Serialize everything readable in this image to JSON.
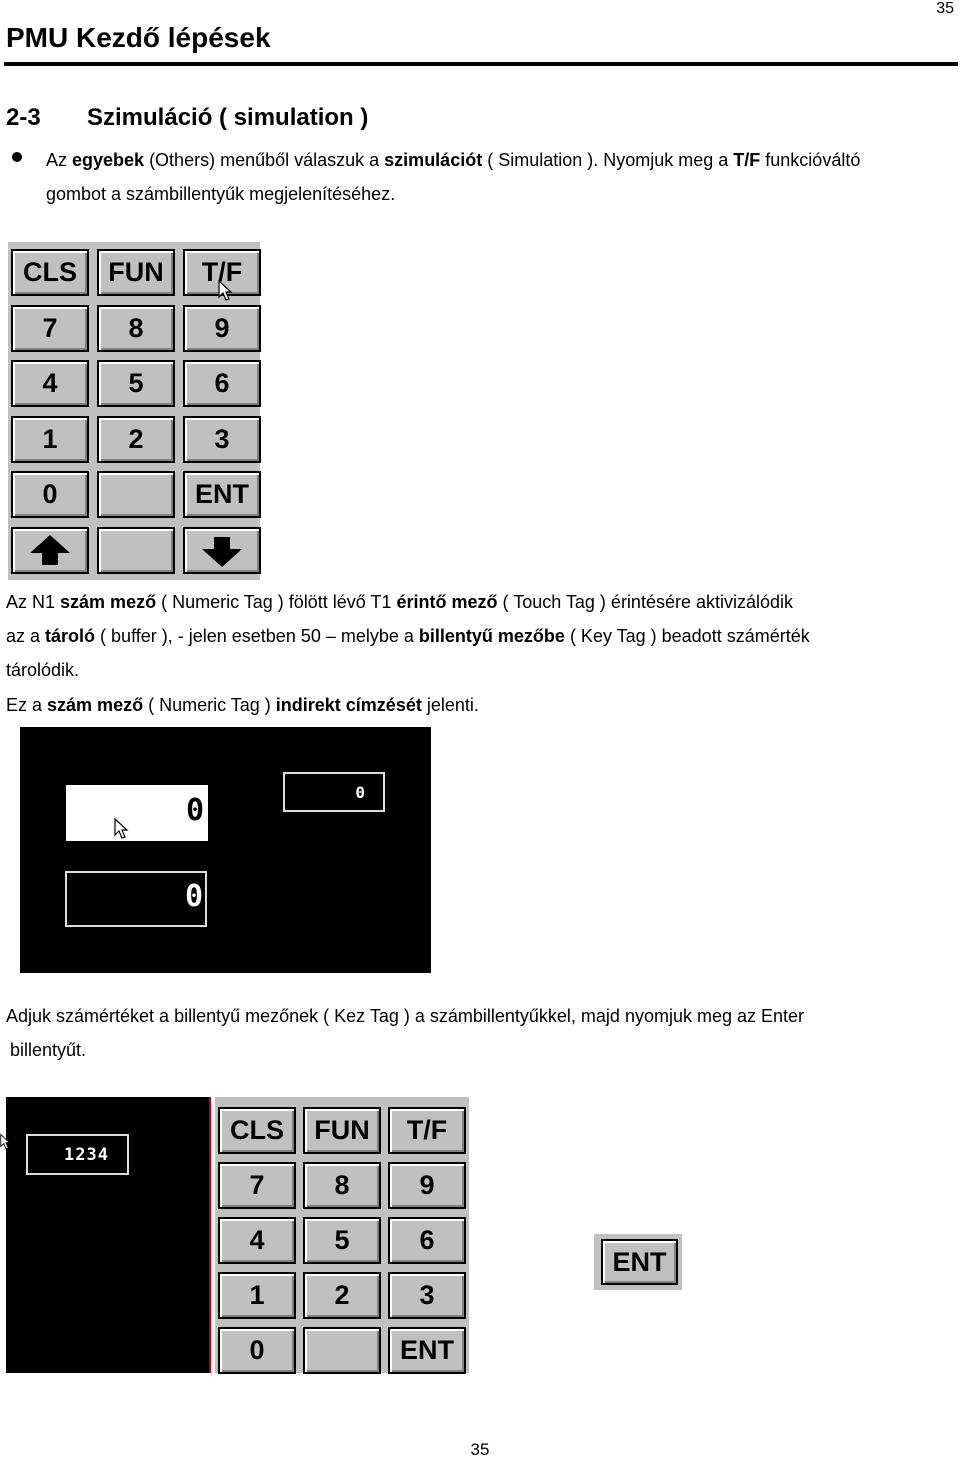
{
  "header": {
    "page_number_top": "35",
    "title": "PMU Kezdő lépések"
  },
  "section": {
    "number": "2-3",
    "title": "Szimuláció ( simulation )"
  },
  "intro_bullet": {
    "line1": [
      "Az ",
      "egyebek",
      " (Others) menűből válaszuk a ",
      "szimulációt",
      " ( Simulation ). Nyomjuk meg a ",
      "T/F",
      " funkcióváltó"
    ],
    "line2": "gombot a számbillentyűk megjelenítéséhez."
  },
  "keypad1": {
    "keys": [
      [
        "CLS",
        "FUN",
        "T/F"
      ],
      [
        "7",
        "8",
        "9"
      ],
      [
        "4",
        "5",
        "6"
      ],
      [
        "1",
        "2",
        "3"
      ],
      [
        "0",
        "",
        "ENT"
      ],
      [
        "arrow-up-icon",
        "",
        "arrow-down-icon"
      ]
    ]
  },
  "paragraph2": {
    "line1": [
      "Az N1 ",
      "szám mező",
      " ( Numeric Tag ) fölött lévő T1 ",
      "érintő mező",
      " ( Touch Tag ) érintésére aktivizálódik"
    ],
    "line2": [
      "az a ",
      "tároló",
      " ( buffer ), - jelen esetben 50 – melybe a ",
      "billentyű mezőbe",
      " ( Key Tag ) beadott számérték"
    ],
    "line3": "tárolódik.",
    "line4": [
      "Ez a ",
      "szám mező",
      " ( Numeric Tag ) ",
      "indirekt címzését",
      " jelenti."
    ]
  },
  "sim_screen1": {
    "touch_field_value": "0",
    "numeric_field_value": "0",
    "small_field_value": "0"
  },
  "paragraph3": {
    "line1": "Adjuk számértéket a billentyű mezőnek ( Kez Tag ) a számbillentyűkkel, majd nyomjuk meg az Enter",
    "line2": "billentyűt."
  },
  "sim_screen2": {
    "field_value": "1234"
  },
  "keypad2": {
    "keys": [
      [
        "CLS",
        "FUN",
        "T/F"
      ],
      [
        "7",
        "8",
        "9"
      ],
      [
        "4",
        "5",
        "6"
      ],
      [
        "1",
        "2",
        "3"
      ],
      [
        "0",
        "",
        "ENT"
      ]
    ]
  },
  "ent_button": {
    "label": "ENT"
  },
  "footer": {
    "page_number": "35"
  }
}
